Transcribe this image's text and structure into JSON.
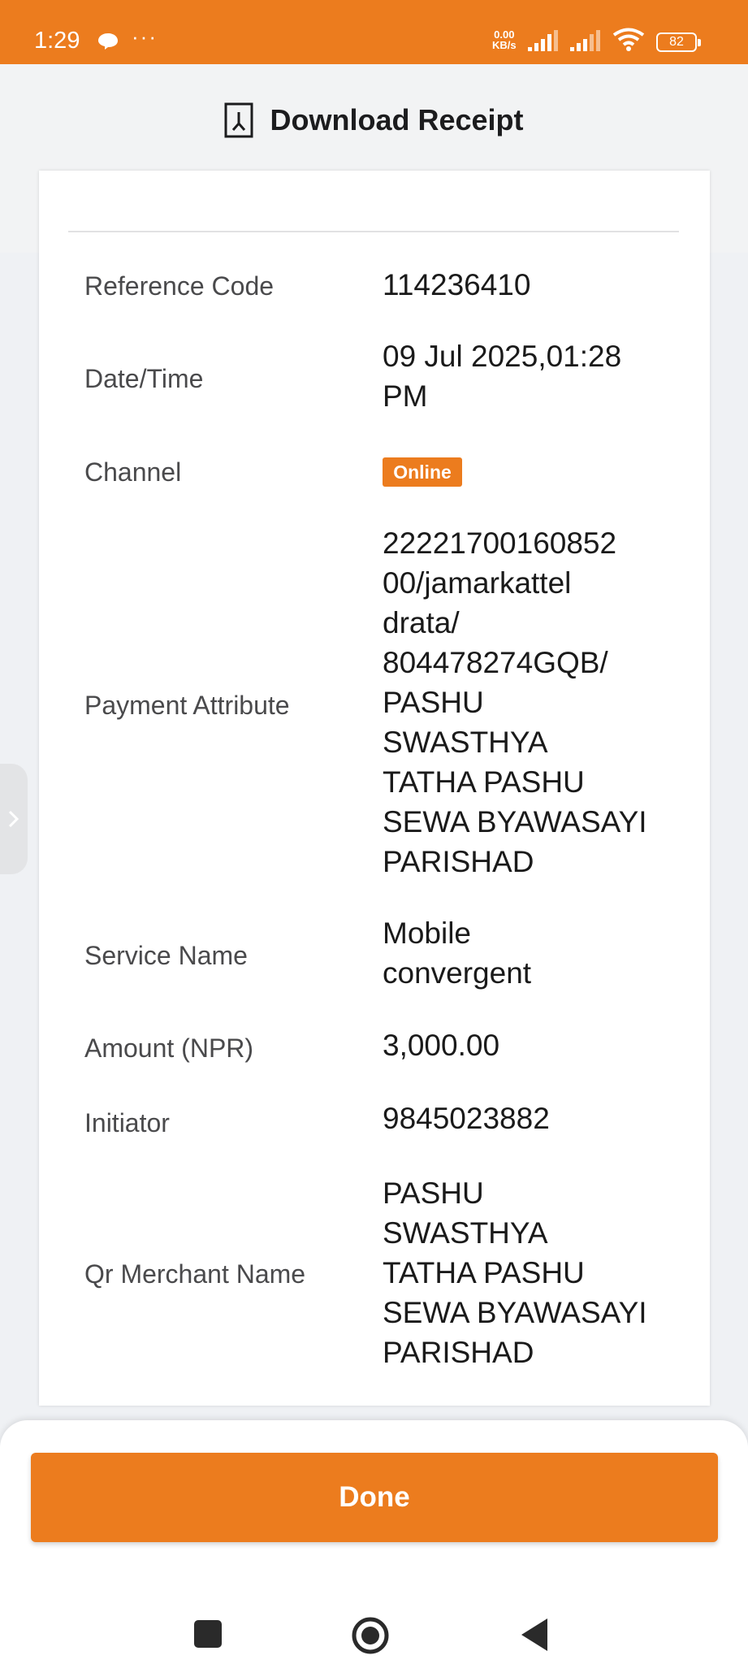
{
  "status_bar": {
    "time": "1:29",
    "more": "···",
    "net_speed_value": "0.00",
    "net_speed_unit": "KB/s",
    "battery": "82"
  },
  "header": {
    "title": "Download Receipt",
    "icon": "pdf-file-icon"
  },
  "receipt": {
    "rows": [
      {
        "label": "Reference Code",
        "value": "114236410"
      },
      {
        "label": "Date/Time",
        "value": "09 Jul 2025,01:28 PM"
      },
      {
        "label": "Channel",
        "value": "Online"
      },
      {
        "label": "Payment Attribute",
        "value": "2222170016085200/jamarkatteldrata/804478274GQB/PASHU SWASTHYA TATHA PASHU SEWA BYAWASAYI PARISHAD"
      },
      {
        "label": "Service Name",
        "value": "Mobile convergent"
      },
      {
        "label": "Amount (NPR)",
        "value": "3,000.00"
      },
      {
        "label": "Initiator",
        "value": "9845023882"
      },
      {
        "label": "Qr Merchant Name",
        "value": "PASHU SWASTHYA TATHA PASHU SEWA BYAWASAYI PARISHAD"
      }
    ],
    "payment_attribute_lines": [
      "22221700160852",
      "00/jamarkattel",
      "drata/",
      "804478274GQB/",
      "PASHU",
      "SWASTHYA",
      "TATHA PASHU",
      "SEWA BYAWASAYI",
      "PARISHAD"
    ],
    "date_lines": [
      "09 Jul 2025,01:28",
      "PM"
    ],
    "service_lines": [
      "Mobile",
      "convergent"
    ],
    "merchant_lines": [
      "PASHU",
      "SWASTHYA",
      "TATHA PASHU",
      "SEWA BYAWASAYI",
      "PARISHAD"
    ]
  },
  "actions": {
    "done_label": "Done"
  },
  "colors": {
    "accent": "#ec7c1e",
    "background": "#eff1f4"
  }
}
